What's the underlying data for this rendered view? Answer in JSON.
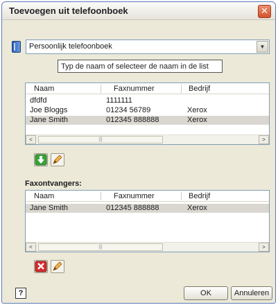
{
  "window": {
    "title": "Toevoegen uit telefoonboek",
    "close_glyph": "✕"
  },
  "phonebook": {
    "selected": "Persoonlijk telefoonboek",
    "arrow": "▼"
  },
  "search": {
    "value": "Typ de naam of selecteer de naam in de list"
  },
  "contacts": {
    "columns": [
      "Naam",
      "Faxnummer",
      "Bedrijf"
    ],
    "rows": [
      {
        "name": "dfdfd",
        "fax": "1111111",
        "company": ""
      },
      {
        "name": "Joe Bloggs",
        "fax": "01234 56789",
        "company": "Xerox"
      },
      {
        "name": "Jane Smith",
        "fax": "012345 888888",
        "company": "Xerox"
      }
    ],
    "scroll_left": "<",
    "scroll_right": ">",
    "scroll_thumb": "|||"
  },
  "recipients": {
    "label": "Faxontvangers:",
    "columns": [
      "Naam",
      "Faxnummer",
      "Bedrijf"
    ],
    "rows": [
      {
        "name": "Jane Smith",
        "fax": "012345 888888",
        "company": "Xerox"
      }
    ],
    "scroll_left": "<",
    "scroll_right": ">",
    "scroll_thumb": "|||"
  },
  "buttons": {
    "ok": "OK",
    "cancel": "Annuleren",
    "help": "?"
  },
  "icons": {
    "add": "down-arrow-icon",
    "edit": "pencil-icon",
    "remove": "delete-icon"
  },
  "colors": {
    "add_green": "#3aa33a",
    "remove_red": "#d42c2c",
    "pencil_orange": "#e58a2c"
  }
}
